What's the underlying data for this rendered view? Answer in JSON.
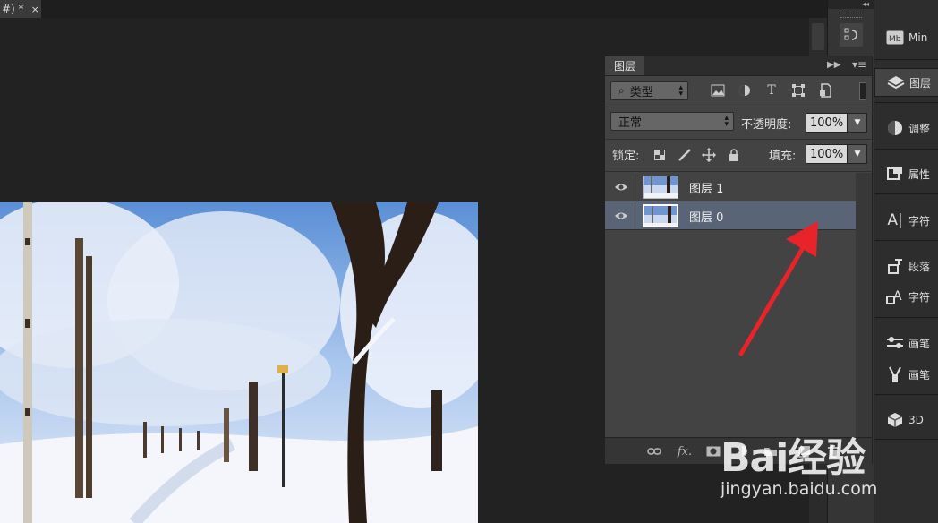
{
  "document": {
    "tab_label": "#) *",
    "close_glyph": "×"
  },
  "right_column": {
    "items": [
      {
        "label": "Min",
        "icon": "mb-icon"
      },
      {
        "label": "图层",
        "icon": "layers-icon"
      },
      {
        "label": "调整",
        "icon": "adjustments-icon"
      },
      {
        "label": "属性",
        "icon": "properties-icon"
      },
      {
        "label": "字符",
        "icon": "character-icon"
      },
      {
        "label": "段落",
        "icon": "paragraph-icon"
      },
      {
        "label": "字符",
        "icon": "character-styles-icon"
      },
      {
        "label": "画笔",
        "icon": "brush-icon"
      },
      {
        "label": "画笔",
        "icon": "brush-presets-icon"
      },
      {
        "label": "3D",
        "icon": "3d-icon"
      }
    ]
  },
  "layers_panel": {
    "tab_label": "图层",
    "filter_kind": "类型",
    "blend_mode": "正常",
    "opacity_label": "不透明度:",
    "opacity_value": "100%",
    "lock_label": "锁定:",
    "fill_label": "填充:",
    "fill_value": "100%",
    "layers": [
      {
        "name": "图层 1",
        "visible": true,
        "selected": false
      },
      {
        "name": "图层 0",
        "visible": true,
        "selected": true
      }
    ],
    "bottom_fx": "fx."
  },
  "watermark": {
    "logo": "Bai经验",
    "url": "jingyan.baidu.com"
  },
  "colors": {
    "annotation_arrow": "#e8232a",
    "selected_layer": "#596476"
  }
}
